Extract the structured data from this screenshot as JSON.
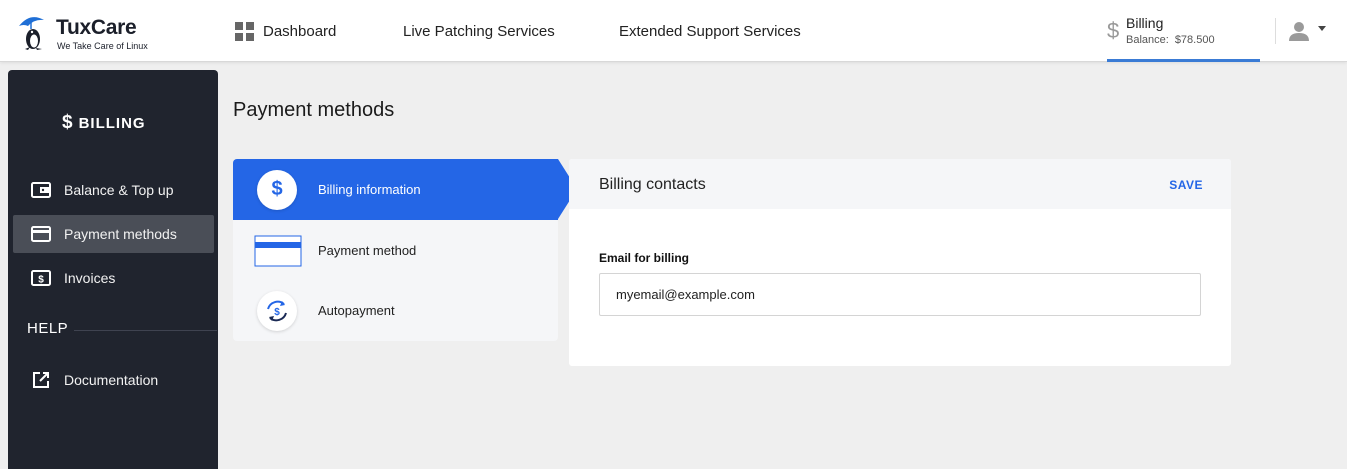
{
  "app": {
    "brand_name": "TuxCare",
    "brand_tagline": "We Take Care of Linux",
    "brand_color": "#1f6fd6"
  },
  "topnav": {
    "items": [
      {
        "label": "Dashboard",
        "icon": "grid-icon"
      },
      {
        "label": "Live Patching Services"
      },
      {
        "label": "Extended Support Services"
      }
    ],
    "billing": {
      "label": "Billing",
      "balance_label": "Balance:",
      "balance_value": "$78.500",
      "icon": "dollar-icon"
    },
    "user_icon": "user-avatar-icon"
  },
  "sidebar": {
    "title": "BILLING",
    "title_icon": "dollar-icon",
    "items": [
      {
        "label": "Balance & Top up",
        "icon": "wallet-icon"
      },
      {
        "label": "Payment methods",
        "icon": "credit-card-icon",
        "active": true
      },
      {
        "label": "Invoices",
        "icon": "invoice-icon"
      }
    ],
    "help_title": "HELP",
    "help_items": [
      {
        "label": "Documentation",
        "icon": "external-link-icon"
      }
    ]
  },
  "main": {
    "page_title": "Payment methods",
    "steps": [
      {
        "label": "Billing information",
        "icon": "dollar-circle-icon",
        "active": true
      },
      {
        "label": "Payment method",
        "icon": "card-icon"
      },
      {
        "label": "Autopayment",
        "icon": "autopay-icon"
      }
    ],
    "card": {
      "title": "Billing contacts",
      "save_label": "SAVE",
      "email_label": "Email for billing",
      "email_value": "myemail@example.com"
    }
  },
  "colors": {
    "accent": "#2466e6",
    "sidebar_bg": "#20242e",
    "sidebar_active": "#4a4e57",
    "page_bg": "#efefef"
  }
}
